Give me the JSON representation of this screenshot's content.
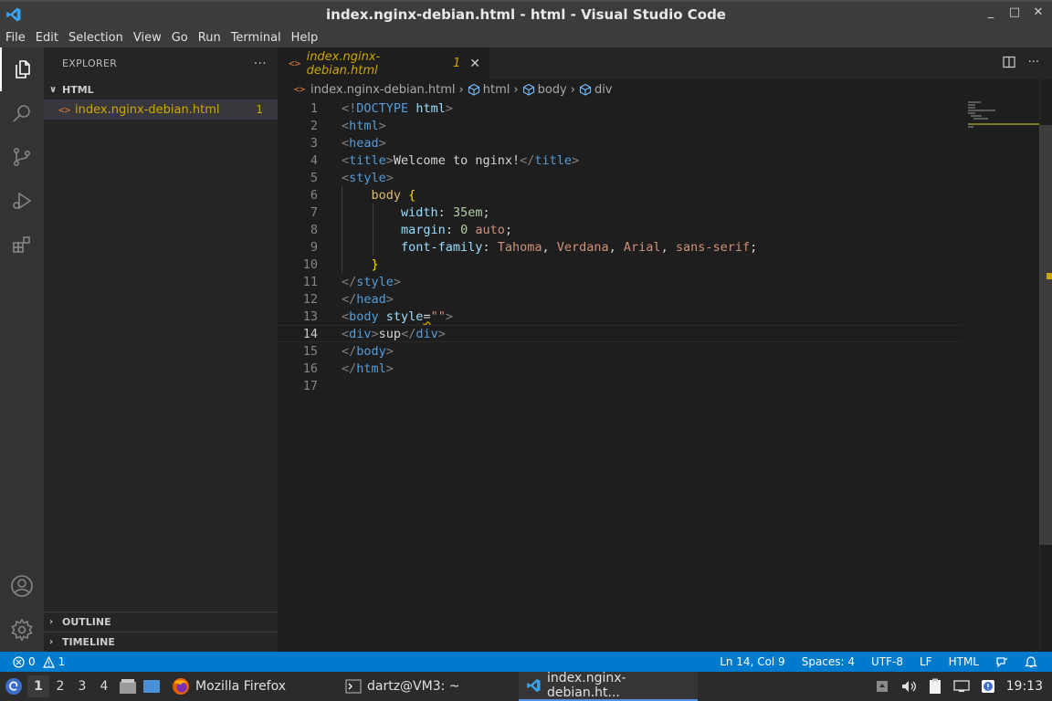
{
  "window": {
    "title": "index.nginx-debian.html - html - Visual Studio Code",
    "minimize": "_",
    "maximize": "□",
    "close": "✕"
  },
  "menu": [
    "File",
    "Edit",
    "Selection",
    "View",
    "Go",
    "Run",
    "Terminal",
    "Help"
  ],
  "activity_bar": {
    "items": [
      "explorer-icon",
      "search-icon",
      "source-control-icon",
      "run-debug-icon",
      "extensions-icon"
    ],
    "bottom": [
      "accounts-icon",
      "settings-gear-icon"
    ]
  },
  "sidebar": {
    "title": "EXPLORER",
    "more": "···",
    "folder": {
      "name": "HTML",
      "chevron": "∨",
      "files": [
        {
          "icon": "<>",
          "name": "index.nginx-debian.html",
          "badge": "1"
        }
      ]
    },
    "outline": "OUTLINE",
    "timeline": "TIMELINE",
    "collapsed_chevron": "›"
  },
  "editor": {
    "tab": {
      "icon": "<>",
      "label": "index.nginx-debian.html",
      "badge": "1",
      "close": "✕"
    },
    "breadcrumb": {
      "file": "index.nginx-debian.html",
      "parts": [
        "html",
        "body",
        "div"
      ],
      "sep": "›",
      "icon": "<>"
    },
    "line_numbers": [
      "1",
      "2",
      "3",
      "4",
      "5",
      "6",
      "7",
      "8",
      "9",
      "10",
      "11",
      "12",
      "13",
      "14",
      "15",
      "16",
      "17"
    ],
    "current_line": "14"
  },
  "status": {
    "errors": "0",
    "warnings": "1",
    "cursor": "Ln 14, Col 9",
    "spaces": "Spaces: 4",
    "encoding": "UTF-8",
    "eol": "LF",
    "language": "HTML"
  },
  "taskbar": {
    "workspaces": [
      "1",
      "2",
      "3",
      "4"
    ],
    "tasks": [
      {
        "label": "Mozilla Firefox",
        "icon": "firefox-icon"
      },
      {
        "label": "dartz@VM3: ~",
        "icon": "terminal-icon"
      },
      {
        "label": "index.nginx-debian.ht...",
        "icon": "vscode-icon"
      }
    ],
    "clock": "19:13"
  },
  "colors": {
    "accent": "#007acc",
    "modified": "#cca700",
    "html_icon": "#e37933"
  }
}
